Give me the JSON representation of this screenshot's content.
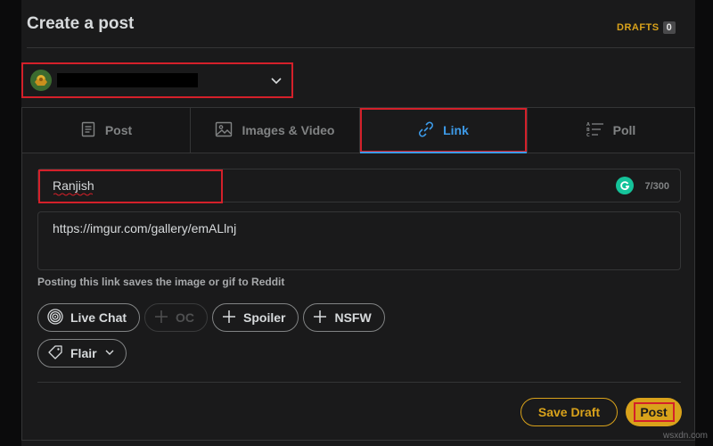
{
  "page": {
    "title": "Create a post",
    "drafts_label": "DRAFTS",
    "drafts_count": "0"
  },
  "community": {
    "name_redacted": true,
    "chevron_icon": "chevron-down-icon"
  },
  "tabs": [
    {
      "label": "Post",
      "icon": "document-icon",
      "active": false
    },
    {
      "label": "Images & Video",
      "icon": "image-icon",
      "active": false
    },
    {
      "label": "Link",
      "icon": "link-icon",
      "active": true
    },
    {
      "label": "Poll",
      "icon": "poll-icon",
      "active": false
    }
  ],
  "form": {
    "title_value": "Ranjish",
    "title_char_count": "7/300",
    "url_value": "https://imgur.com/gallery/emALlnj",
    "helper_text": "Posting this link saves the image or gif to Reddit"
  },
  "tags": {
    "live_chat": "Live Chat",
    "oc": "OC",
    "spoiler": "Spoiler",
    "nsfw": "NSFW",
    "flair": "Flair"
  },
  "actions": {
    "save_draft": "Save Draft",
    "post": "Post"
  },
  "watermark": "wsxdn.com",
  "colors": {
    "accent_gold": "#d9a21b",
    "active_tab_blue": "#3d9be9",
    "highlight_red": "#d4202a",
    "background": "#1a1a1b"
  }
}
